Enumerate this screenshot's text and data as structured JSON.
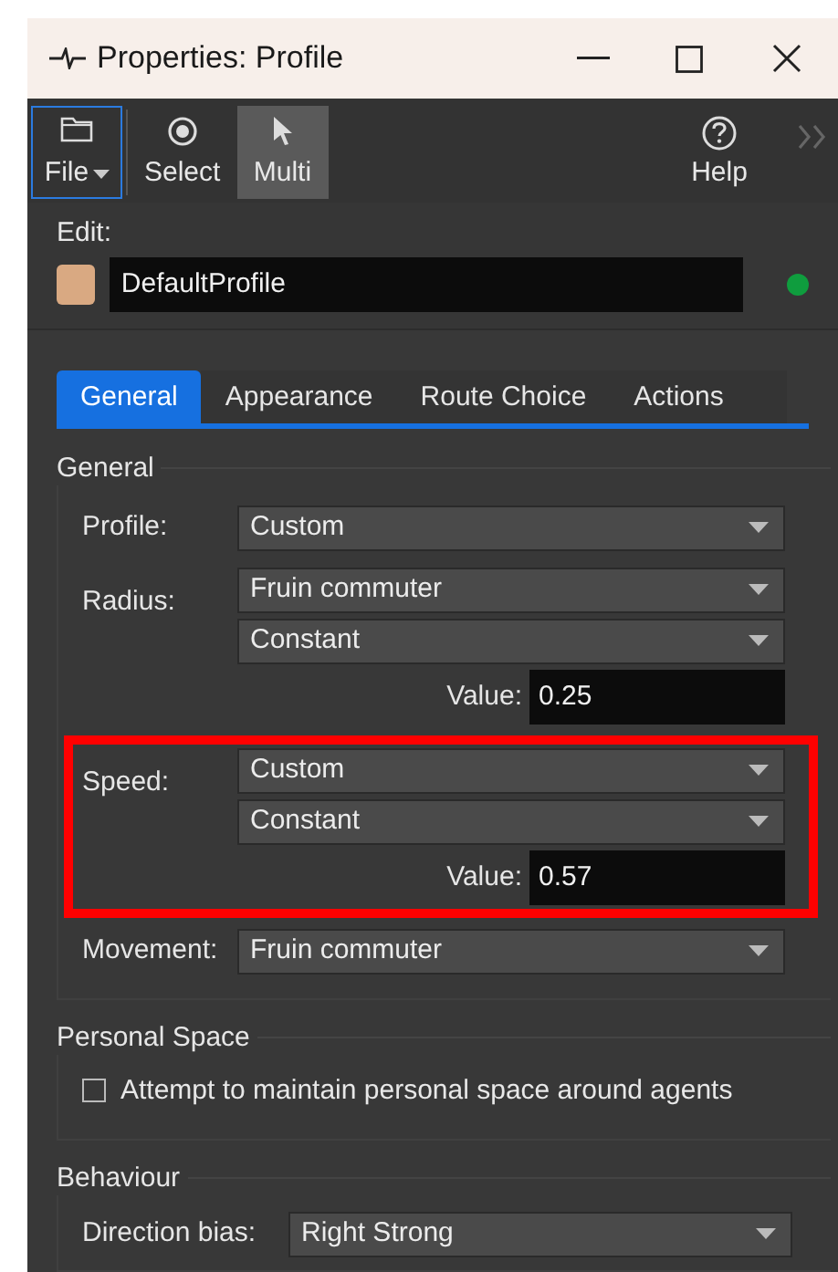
{
  "window": {
    "title": "Properties: Profile"
  },
  "toolbar": [
    {
      "kind": "file",
      "label": "File",
      "focused": true,
      "selected": false
    },
    {
      "kind": "select",
      "label": "Select",
      "focused": false,
      "selected": false
    },
    {
      "kind": "multi",
      "label": "Multi",
      "focused": false,
      "selected": true
    },
    {
      "kind": "help",
      "label": "Help",
      "focused": false,
      "selected": false
    }
  ],
  "edit": {
    "label": "Edit:",
    "color": "#d9a982",
    "value": "DefaultProfile",
    "indicator": {
      "color": "#0f9d3e"
    }
  },
  "tabs": [
    {
      "label": "General",
      "selected": true
    },
    {
      "label": "Appearance",
      "selected": false
    },
    {
      "label": "Route Choice",
      "selected": false
    },
    {
      "label": "Actions",
      "selected": false
    }
  ],
  "sections": [
    {
      "title": "General",
      "rows": [
        {
          "label": "Profile:",
          "highlighted": false,
          "controls": [
            {
              "kind": "dropdown",
              "value": "Custom"
            }
          ]
        },
        {
          "label": "Radius:",
          "highlighted": false,
          "controls": [
            {
              "kind": "dropdown",
              "value": "Fruin commuter"
            },
            {
              "kind": "dropdown",
              "value": "Constant"
            },
            {
              "kind": "number",
              "label": "Value:",
              "value": "0.25"
            }
          ]
        },
        {
          "label": "Speed:",
          "highlighted": true,
          "controls": [
            {
              "kind": "dropdown",
              "value": "Custom"
            },
            {
              "kind": "dropdown",
              "value": "Constant"
            },
            {
              "kind": "number",
              "label": "Value:",
              "value": "0.57"
            }
          ]
        },
        {
          "label": "Movement:",
          "highlighted": false,
          "controls": [
            {
              "kind": "dropdown",
              "value": "Fruin commuter"
            }
          ]
        }
      ]
    },
    {
      "title": "Personal Space",
      "rows": [
        {
          "kind": "checkbox",
          "label": "Attempt to maintain personal space around agents",
          "checked": false
        }
      ]
    },
    {
      "title": "Behaviour",
      "rows": [
        {
          "label": "Direction bias:",
          "highlighted": false,
          "wide": true,
          "controls": [
            {
              "kind": "dropdown",
              "value": "Right Strong"
            }
          ]
        }
      ]
    }
  ]
}
